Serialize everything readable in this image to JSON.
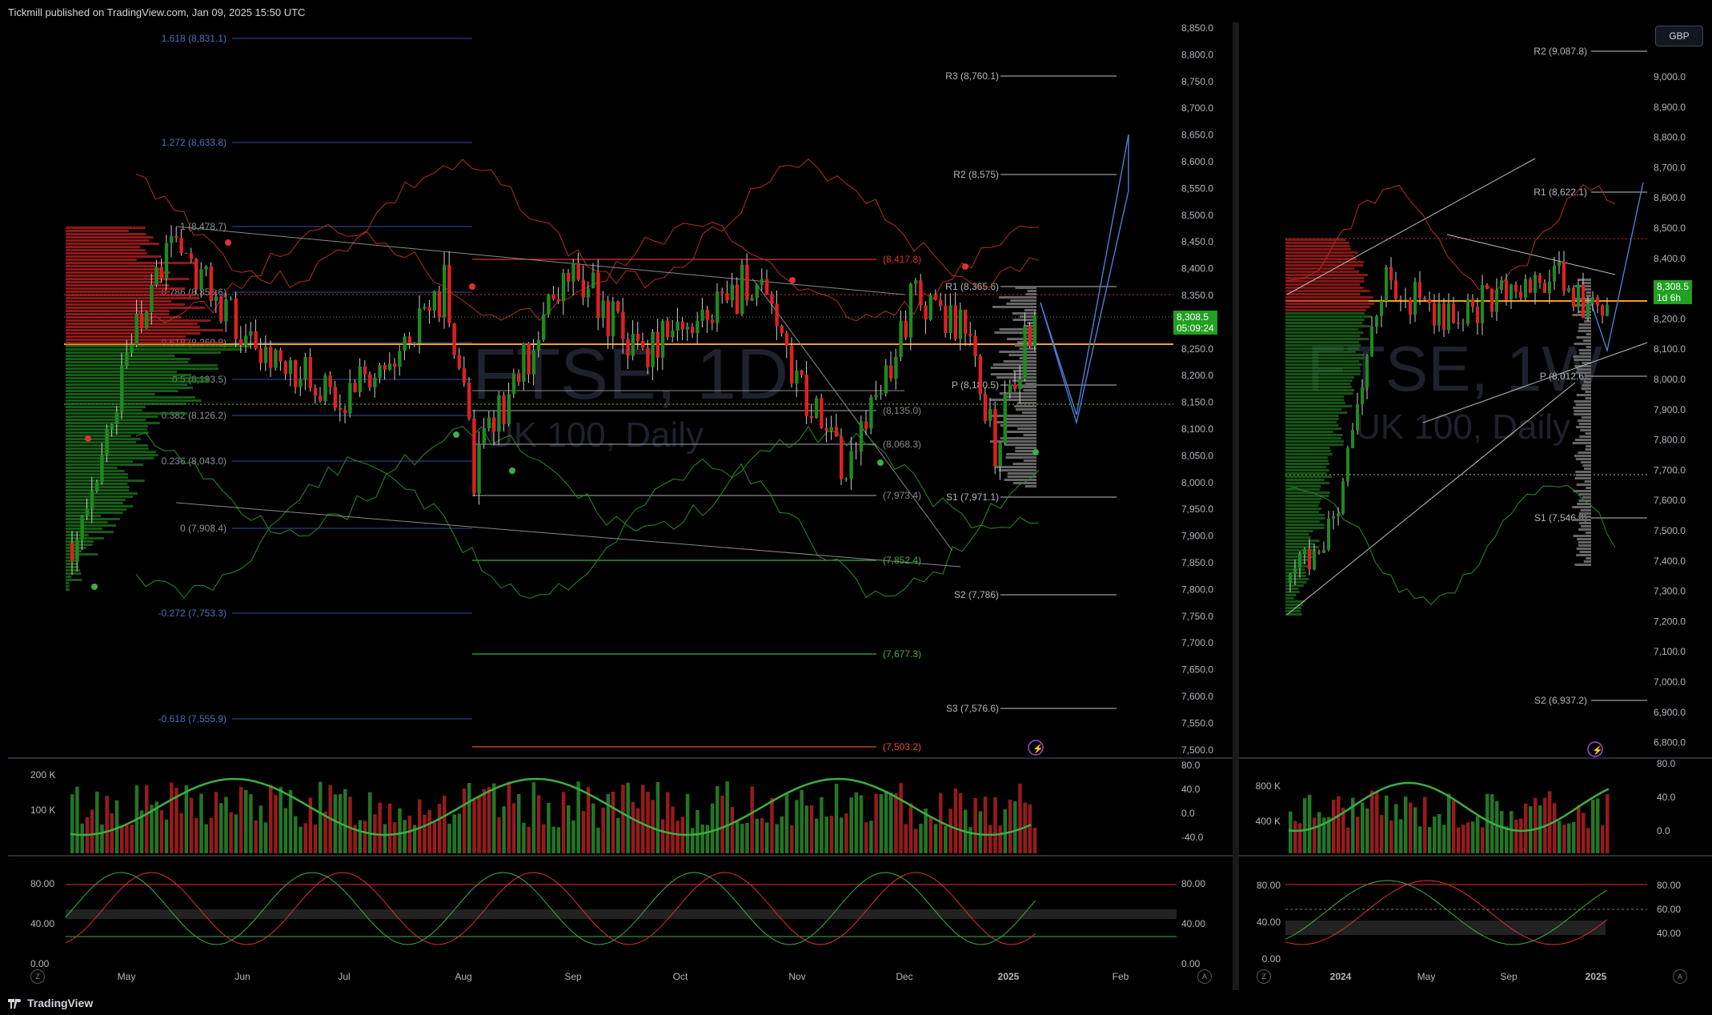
{
  "header": {
    "published_by": "Tickmill published on TradingView.com, Jan 09, 2025 15:50 UTC"
  },
  "footer": {
    "brand": "TradingView",
    "left_button": "Z",
    "right_button": "A"
  },
  "left_chart": {
    "watermark_symbol": "FTSE, 1D",
    "watermark_name": "UK 100, Daily",
    "price_axis": [
      "8,850.0",
      "8,800.0",
      "8,750.0",
      "8,700.0",
      "8,650.0",
      "8,600.0",
      "8,550.0",
      "8,500.0",
      "8,450.0",
      "8,400.0",
      "8,350.0",
      "8,300.0",
      "8,250.0",
      "8,200.0",
      "8,150.0",
      "8,100.0",
      "8,050.0",
      "8,000.0",
      "7,950.0",
      "7,900.0",
      "7,850.0",
      "7,800.0",
      "7,750.0",
      "7,700.0",
      "7,650.0",
      "7,600.0",
      "7,550.0",
      "7,500.0"
    ],
    "time_axis": [
      "May",
      "Jun",
      "Jul",
      "Aug",
      "Sep",
      "Oct",
      "Nov",
      "Dec",
      "2025",
      "Feb"
    ],
    "last_price": "8,308.5",
    "countdown": "05:09:24",
    "fib_levels": [
      "1.618 (8,831.1)",
      "1.272 (8,633.8)",
      "1 (8,478.7)",
      "0.786 (8,356.6)",
      "0.618 (8,260.8)",
      "0.5 (8,193.5)",
      "0.382 (8,126.2)",
      "0.236 (8,043.0)",
      "0 (7,908.4)",
      "-0.272 (7,753.3)",
      "-0.618 (7,555.9)"
    ],
    "pivot_levels": [
      "R3 (8,760.1)",
      "R2 (8,575)",
      "R1 (8,365.6)",
      "P (8,180.5)",
      "S1 (7,971.1)",
      "S2 (7,786)",
      "S3 (7,576.6)"
    ],
    "hline_labels": [
      "(8,417.8)",
      "(8,135.0)",
      "(8,068.3)",
      "(7,973.4)",
      "(7,852.4)",
      "(7,677.3)",
      "(7,503.2)"
    ],
    "volume_axis": [
      "200 K",
      "100 K"
    ],
    "osc_axis": [
      "80.0",
      "40.0",
      "0.0",
      "-40.0"
    ],
    "stoch_axis_left": [
      "80.00",
      "40.00",
      "0.00"
    ],
    "stoch_axis_right": [
      "80.00",
      "40.00",
      "0.00"
    ]
  },
  "right_chart": {
    "currency": "GBP",
    "watermark_symbol": "FTSE, 1W",
    "watermark_name": "UK 100, Daily",
    "price_axis": [
      "9,000.0",
      "8,900.0",
      "8,800.0",
      "8,700.0",
      "8,600.0",
      "8,500.0",
      "8,400.0",
      "8,300.0",
      "8,200.0",
      "8,100.0",
      "8,000.0",
      "7,900.0",
      "7,800.0",
      "7,700.0",
      "7,600.0",
      "7,500.0",
      "7,400.0",
      "7,300.0",
      "7,200.0",
      "7,100.0",
      "7,000.0",
      "6,900.0",
      "6,800.0"
    ],
    "time_axis": [
      "2024",
      "May",
      "Sep",
      "2025"
    ],
    "last_price": "8,308.5",
    "countdown": "1d 6h",
    "pivot_levels": [
      "R2 (9,087.8)",
      "R1 (8,622.1)",
      "P (8,012.6)",
      "S1 (7,546.8)",
      "S2 (6,937.2)"
    ],
    "volume_axis": [
      "800 K",
      "400 K"
    ],
    "osc_axis": [
      "80.0",
      "40.0",
      "0.0"
    ],
    "stoch_axis_left": [
      "80.00",
      "40.00",
      "0.00"
    ],
    "stoch_axis_right": [
      "80.00",
      "60.00",
      "40.00"
    ]
  },
  "colors": {
    "bull": "#1e8a1e",
    "bear": "#e02020",
    "pivot": "#bfbfbf",
    "fib": "#2f4f9f",
    "orange": "#f0a020",
    "price_tag": "#22a022"
  }
}
